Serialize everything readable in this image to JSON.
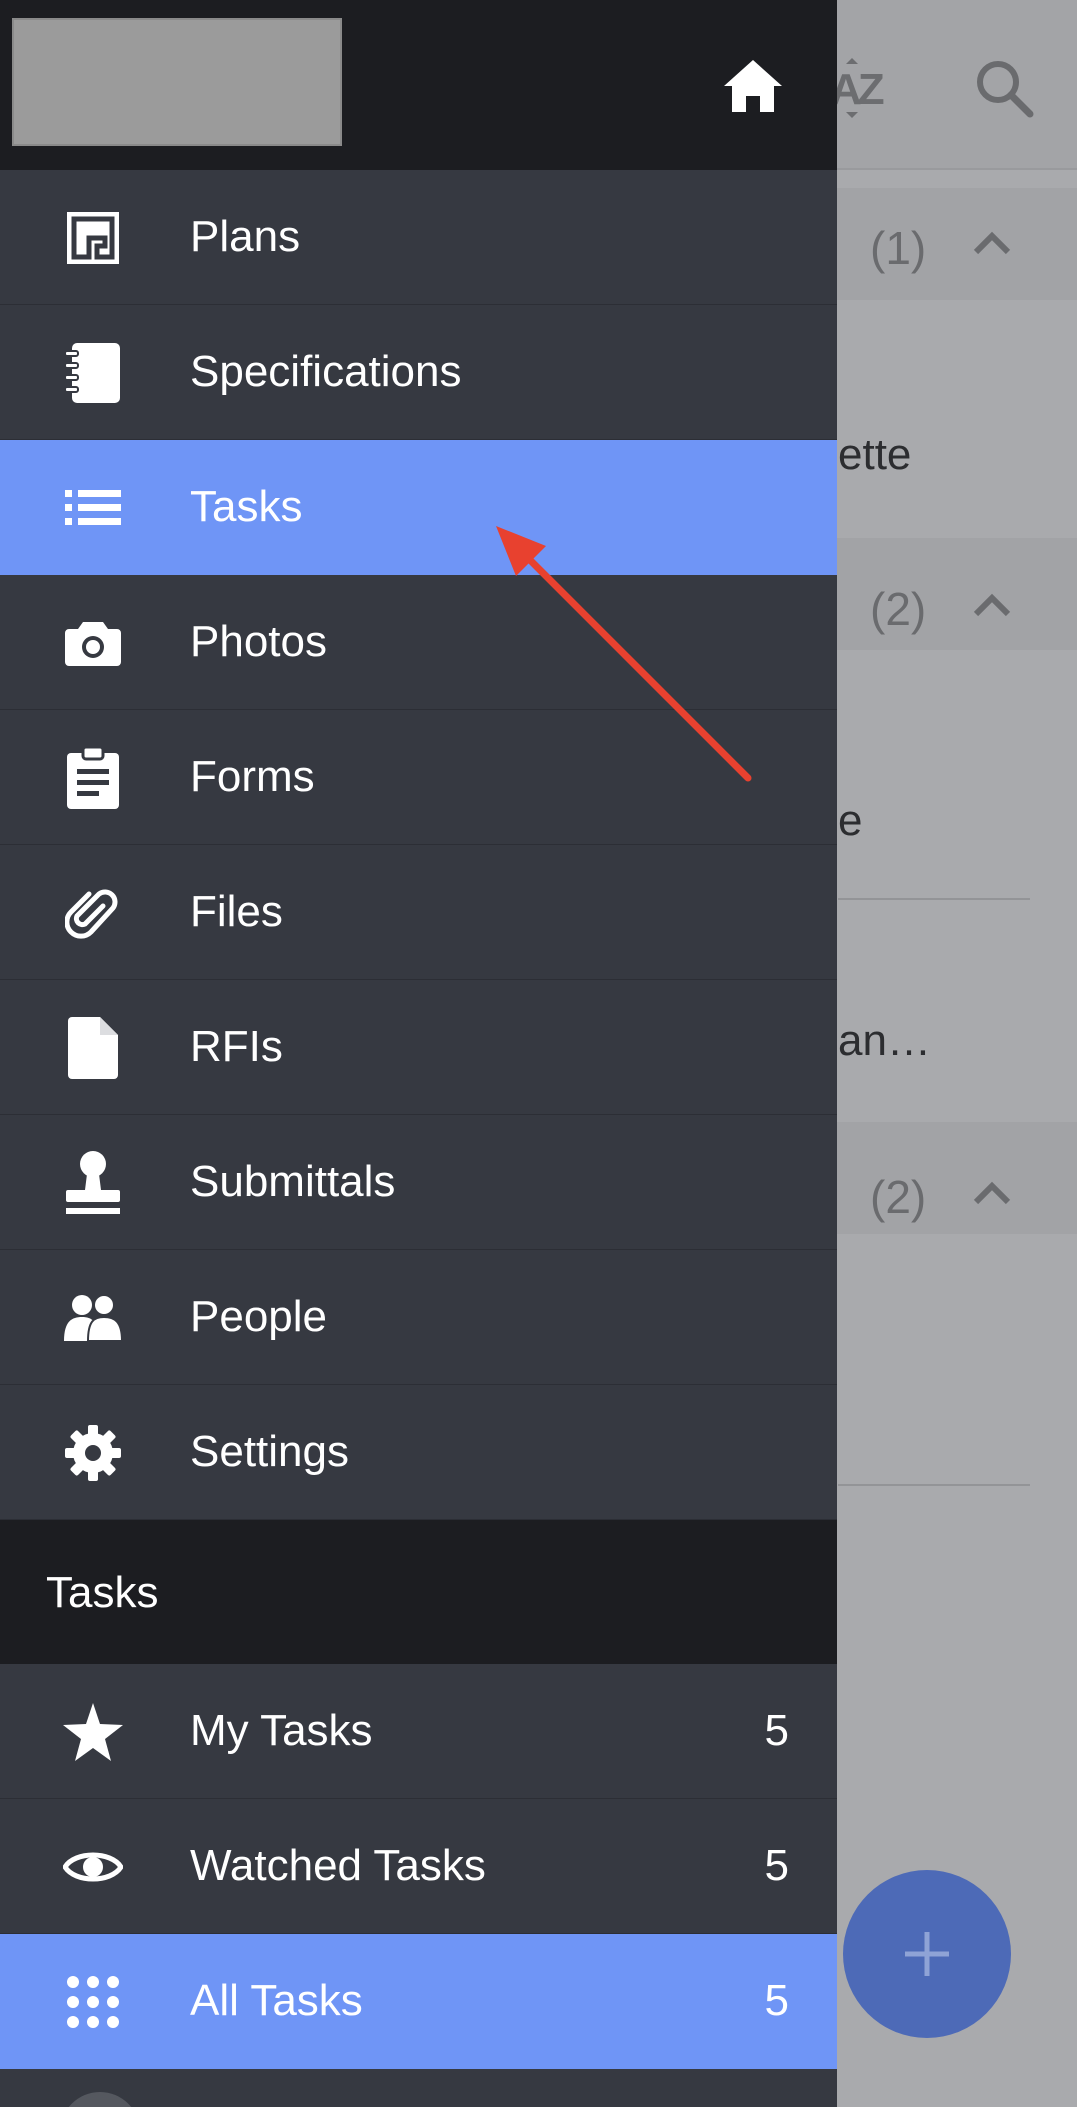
{
  "background": {
    "groups": [
      {
        "count": "(1)"
      },
      {
        "count": "(2)"
      },
      {
        "count": "(2)"
      }
    ],
    "row_fragments": [
      "ette",
      "e",
      "an…"
    ],
    "fab_label": "+"
  },
  "drawer": {
    "nav_items": [
      {
        "label": "Plans",
        "icon": "floor-plan-icon"
      },
      {
        "label": "Specifications",
        "icon": "notebook-icon"
      },
      {
        "label": "Tasks",
        "icon": "list-icon",
        "active": true
      },
      {
        "label": "Photos",
        "icon": "camera-icon"
      },
      {
        "label": "Forms",
        "icon": "clipboard-icon"
      },
      {
        "label": "Files",
        "icon": "paperclip-icon"
      },
      {
        "label": "RFIs",
        "icon": "document-icon"
      },
      {
        "label": "Submittals",
        "icon": "stamp-icon"
      },
      {
        "label": "People",
        "icon": "people-icon"
      },
      {
        "label": "Settings",
        "icon": "gear-icon"
      }
    ],
    "section_title": "Tasks",
    "task_filters": [
      {
        "label": "My Tasks",
        "count": "5",
        "icon": "star-icon"
      },
      {
        "label": "Watched Tasks",
        "count": "5",
        "icon": "eye-icon"
      },
      {
        "label": "All Tasks",
        "count": "5",
        "icon": "grid-icon",
        "active": true
      }
    ]
  },
  "colors": {
    "drawer_bg": "#363941",
    "drawer_header_bg": "#1c1d21",
    "active_item": "#6f95f6",
    "annotation_arrow": "#e8412f",
    "fab": "#4d6ab7"
  }
}
